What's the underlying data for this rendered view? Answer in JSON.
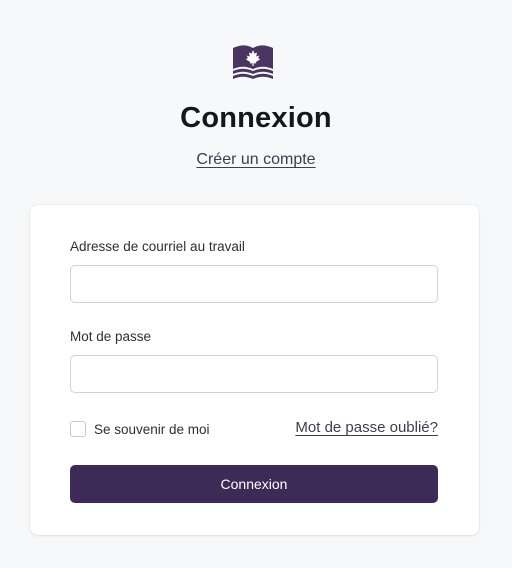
{
  "colors": {
    "brand": "#3d2a56",
    "background": "#f7f8fa",
    "card": "#ffffff",
    "border": "#cfd3da"
  },
  "logo": {
    "icon": "maple-leaf-waves-icon"
  },
  "header": {
    "title": "Connexion",
    "create_account_label": "Créer un compte"
  },
  "form": {
    "email_label": "Adresse de courriel au travail",
    "email_value": "",
    "password_label": "Mot de passe",
    "password_value": "",
    "remember_label": "Se souvenir de moi",
    "remember_checked": false,
    "forgot_label": "Mot de passe oublié?",
    "submit_label": "Connexion"
  }
}
